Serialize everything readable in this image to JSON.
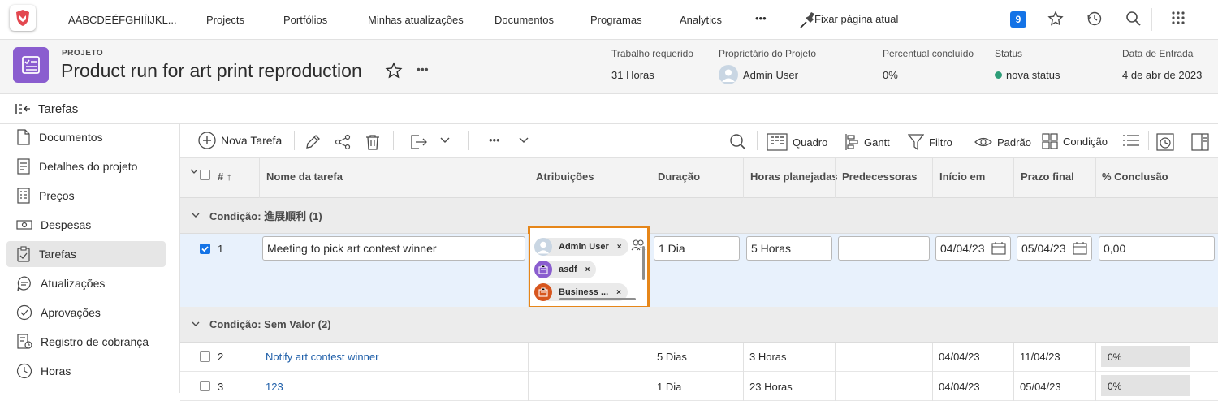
{
  "topnav": {
    "workspace": "AÁBCDEÉFGHIÍÏJKL...",
    "items": [
      "Projects",
      "Portfólios",
      "Minhas atualizações",
      "Documentos",
      "Programas",
      "Analytics"
    ],
    "more": "•••",
    "pin": "Fixar página atual",
    "notifications": "9"
  },
  "project": {
    "label": "PROJETO",
    "title": "Product run for art print reproduction",
    "more": "•••",
    "fields": [
      {
        "label": "Trabalho requerido",
        "value": "31 Horas"
      },
      {
        "label": "Proprietário do Projeto",
        "value": "Admin User"
      },
      {
        "label": "Percentual concluído",
        "value": "0%"
      },
      {
        "label": "Status",
        "value": "nova status",
        "dot_color": "#2d9d78"
      },
      {
        "label": "Data de Entrada",
        "value": "4 de abr de 2023"
      }
    ]
  },
  "tabs": {
    "current": "Tarefas"
  },
  "sidebar": {
    "items": [
      {
        "label": "Documentos",
        "icon": "document-icon"
      },
      {
        "label": "Detalhes do projeto",
        "icon": "details-icon"
      },
      {
        "label": "Preços",
        "icon": "pricing-icon"
      },
      {
        "label": "Despesas",
        "icon": "expenses-icon"
      },
      {
        "label": "Tarefas",
        "icon": "tasks-icon",
        "active": true
      },
      {
        "label": "Atualizações",
        "icon": "updates-icon"
      },
      {
        "label": "Aprovações",
        "icon": "approvals-icon"
      },
      {
        "label": "Registro de cobrança",
        "icon": "billing-icon"
      },
      {
        "label": "Horas",
        "icon": "hours-icon"
      }
    ]
  },
  "toolbar": {
    "new_task": "Nova Tarefa",
    "more": "•••",
    "board": "Quadro",
    "gantt": "Gantt",
    "filter": "Filtro",
    "view": "Padrão",
    "grouping": "Condição"
  },
  "columns": {
    "num": "#",
    "name": "Nome da tarefa",
    "assignments": "Atribuições",
    "duration": "Duração",
    "planned_hours": "Horas planejadas",
    "predecessors": "Predecessoras",
    "start": "Início em",
    "due": "Prazo final",
    "percent": "% Conclusão"
  },
  "groups": [
    {
      "label": "Condição: 進展順利 (1)",
      "rows": [
        {
          "num": "1",
          "name": "Meeting to pick art contest winner",
          "assignees": [
            {
              "name": "Admin User",
              "type": "user"
            },
            {
              "name": "asdf",
              "type": "role",
              "color": "#8a5dcf"
            },
            {
              "name": "Business ...",
              "type": "role",
              "color": "#d7561e"
            }
          ],
          "duration": "1 Dia",
          "planned_hours": "5 Horas",
          "predecessors": "",
          "start": "04/04/23",
          "due": "05/04/23",
          "percent": "0,00",
          "selected": true
        }
      ]
    },
    {
      "label": "Condição: Sem Valor (2)",
      "rows": [
        {
          "num": "2",
          "name": "Notify art contest winner",
          "duration": "5 Dias",
          "planned_hours": "3 Horas",
          "start": "04/04/23",
          "due": "11/04/23",
          "percent": "0%"
        },
        {
          "num": "3",
          "name": "123",
          "duration": "1 Dia",
          "planned_hours": "23 Horas",
          "start": "04/04/23",
          "due": "05/04/23",
          "percent": "0%"
        }
      ]
    }
  ],
  "colors": {
    "accent": "#1473e6",
    "highlight": "#e68619",
    "project_icon": "#8a5dcf",
    "link": "#1f5fa9"
  }
}
